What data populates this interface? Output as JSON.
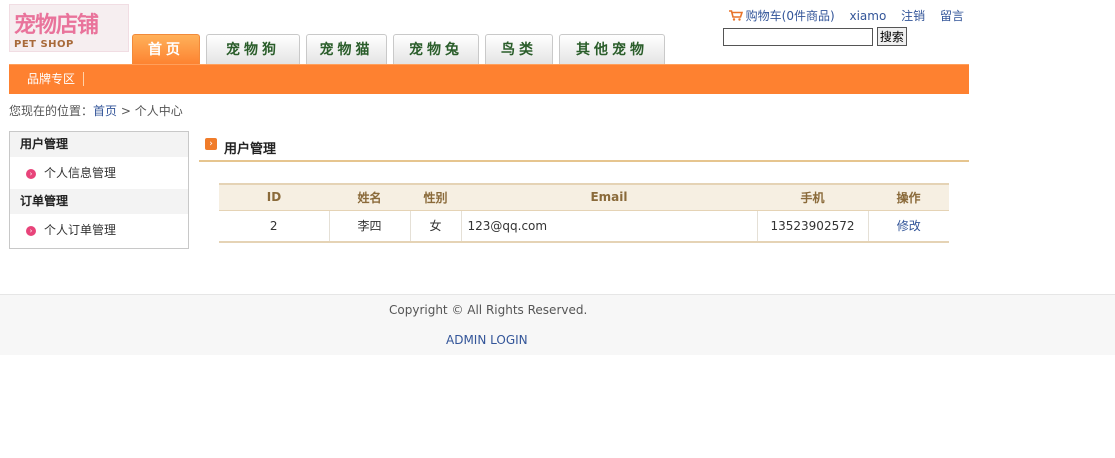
{
  "logo": {
    "cn_text": "宠物店铺",
    "en_text": "PET SHOP"
  },
  "topbar": {
    "cart_label": "购物车(0件商品)",
    "user_label": "xiamo",
    "logout_label": "注销",
    "message_label": "留言"
  },
  "search": {
    "value": "",
    "button_label": "搜索"
  },
  "nav": {
    "tabs": [
      {
        "label": "首页"
      },
      {
        "label": "宠物狗"
      },
      {
        "label": "宠物猫"
      },
      {
        "label": "宠物兔"
      },
      {
        "label": "鸟类"
      },
      {
        "label": "其他宠物"
      }
    ],
    "sub_label": "品牌专区"
  },
  "breadcrumb": {
    "prefix": "您现在的位置：",
    "home": "首页",
    "sep": ">",
    "current": "个人中心"
  },
  "sidebar": {
    "group1": {
      "title": "用户管理",
      "item": "个人信息管理"
    },
    "group2": {
      "title": "订单管理",
      "item": "个人订单管理"
    }
  },
  "main": {
    "title": "用户管理",
    "table": {
      "headers": [
        "ID",
        "姓名",
        "性别",
        "Email",
        "手机",
        "操作"
      ],
      "rows": [
        [
          "2",
          "李四",
          "女",
          "123@qq.com",
          "13523902572",
          "修改"
        ]
      ]
    }
  },
  "footer": {
    "copyright": "Copyright © All Rights Reserved.",
    "admin_link": "ADMIN LOGIN"
  },
  "colors": {
    "accent": "#fe8130",
    "link": "#335599",
    "table_header_bg": "#f6efe2"
  }
}
